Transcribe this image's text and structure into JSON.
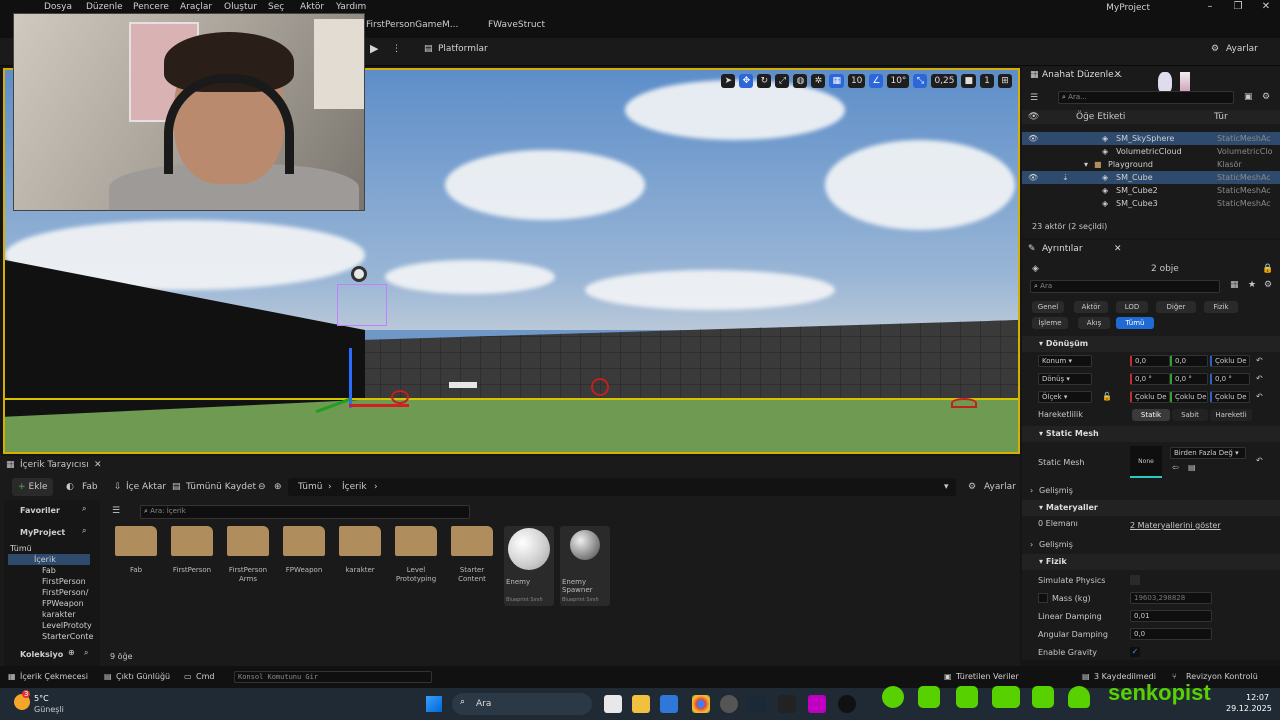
{
  "menu": [
    "Dosya",
    "Düzenle",
    "Pencere",
    "Araçlar",
    "Oluştur",
    "Seç",
    "Aktör",
    "Yardım"
  ],
  "window_title": "MyProject",
  "doc_tabs": [
    "FirstPersonGameM...",
    "FWaveStruct"
  ],
  "toolbar": {
    "platforms": "Platformlar",
    "settings": "Ayarlar"
  },
  "viewport_tools": {
    "grid": "10",
    "angle": "10°",
    "scale": "0,25",
    "camera": "1"
  },
  "outliner": {
    "tab": "Anahat Düzenle...",
    "search_placeholder": "Ara...",
    "col_label": "Öğe Etiketi",
    "col_type": "Tür",
    "rows": [
      {
        "name": "SM_SkySphere",
        "type": "StaticMeshAc"
      },
      {
        "name": "VolumetricCloud",
        "type": "VolumetricClo"
      },
      {
        "name": "Playground",
        "type": "Klasör"
      },
      {
        "name": "SM_Cube",
        "type": "StaticMeshAc"
      },
      {
        "name": "SM_Cube2",
        "type": "StaticMeshAc"
      },
      {
        "name": "SM_Cube3",
        "type": "StaticMeshAc"
      }
    ],
    "footer": "23 aktör (2 seçildi)"
  },
  "details": {
    "tab": "Ayrıntılar",
    "count": "2 obje",
    "search_placeholder": "Ara",
    "cats_row1": [
      "Genel",
      "Aktör",
      "LOD",
      "Diğer",
      "Fizik"
    ],
    "cats_row2": [
      "İşleme",
      "Akış",
      "Tümü"
    ],
    "sec_transform": "Dönüşüm",
    "location": "Konum",
    "rotation": "Dönüş",
    "scale": "Ölçek",
    "loc_vals": [
      "0,0",
      "0,0",
      "Çoklu De"
    ],
    "rot_vals": [
      "0,0 °",
      "0,0 °",
      "0,0 °"
    ],
    "scale_vals": [
      "Çoklu De",
      "Çoklu De",
      "Çoklu De"
    ],
    "mobility": "Hareketlilik",
    "mob_opts": [
      "Statik",
      "Sabit",
      "Hareketli"
    ],
    "sec_mesh": "Static Mesh",
    "mesh_label": "Static Mesh",
    "mesh_thumb": "None",
    "mesh_value": "Birden Fazla Değ",
    "advanced": "Gelişmiş",
    "sec_materials": "Materyaller",
    "elements": "0 Elemanı",
    "show_materials": "2 Materyallerini göster",
    "advanced2": "Gelişmiş",
    "sec_physics": "Fizik",
    "simulate": "Simulate Physics",
    "mass": "Mass (kg)",
    "mass_val": "19603,298828",
    "linear": "Linear Damping",
    "linear_val": "0,01",
    "angular": "Angular Damping",
    "angular_val": "0,0",
    "gravity": "Enable Gravity"
  },
  "content": {
    "tab": "İçerik Tarayıcısı",
    "add": "Ekle",
    "fab": "Fab",
    "import": "İçe Aktar",
    "save_all": "Tümünü Kaydet",
    "crumb_all": "Tümü",
    "crumb_content": "İçerik",
    "settings": "Ayarlar",
    "search_placeholder": "Ara: İçerik",
    "favorites": "Favoriler",
    "project": "MyProject",
    "tree": [
      "Tümü",
      "İçerik",
      "Fab",
      "FirstPerson",
      "FirstPerson/",
      "FPWeapon",
      "karakter",
      "LevelPrototy",
      "StarterConte"
    ],
    "collections": "Koleksiyo",
    "assets": [
      "Fab",
      "FirstPerson",
      "FirstPerson Arms",
      "FPWeapon",
      "karakter",
      "Level Prototyping",
      "Starter Content"
    ],
    "bp1": "Enemy",
    "bp2": "Enemy Spawner",
    "bp_type": "Blueprint Sınıfı",
    "item_count": "9 öğe"
  },
  "status": {
    "drawer": "İçerik Çekmecesi",
    "log": "Çıktı Günlüğü",
    "cmd": "Cmd",
    "cmd_placeholder": "Konsol Komutunu Gir",
    "derived": "Türetilen Veriler",
    "saved": "3 Kaydedilmedi",
    "revision": "Revizyon Kontrolü"
  },
  "taskbar": {
    "temp": "5°C",
    "weather": "Güneşli",
    "search": "Ara",
    "time": "12:07",
    "date": "29.12.2025",
    "notif": "3"
  },
  "overlay": {
    "brand": "senkopist"
  }
}
